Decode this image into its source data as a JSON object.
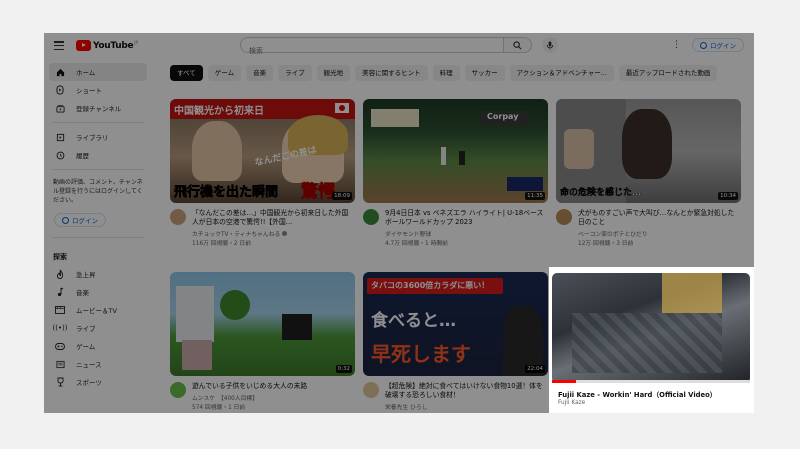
{
  "header": {
    "logo_text": "YouTube",
    "logo_region": "JP",
    "search_placeholder": "検索",
    "login_label": "ログイン"
  },
  "sidebar": {
    "primary": [
      {
        "label": "ホーム",
        "icon": "home-icon"
      },
      {
        "label": "ショート",
        "icon": "shorts-icon"
      },
      {
        "label": "登録チャンネル",
        "icon": "subscriptions-icon"
      }
    ],
    "secondary": [
      {
        "label": "ライブラリ",
        "icon": "library-icon"
      },
      {
        "label": "履歴",
        "icon": "history-icon"
      }
    ],
    "note": "動画の評価、コメント、チャンネル登録を行うにはログインしてください。",
    "login_label": "ログイン",
    "explore_heading": "探索",
    "explore": [
      {
        "label": "急上昇",
        "icon": "trending-icon"
      },
      {
        "label": "音楽",
        "icon": "music-icon"
      },
      {
        "label": "ムービー＆TV",
        "icon": "movie-icon"
      },
      {
        "label": "ライブ",
        "icon": "live-icon"
      },
      {
        "label": "ゲーム",
        "icon": "gaming-icon"
      },
      {
        "label": "ニュース",
        "icon": "news-icon"
      },
      {
        "label": "スポーツ",
        "icon": "sports-icon"
      }
    ]
  },
  "chips": [
    "すべて",
    "ゲーム",
    "音楽",
    "ライブ",
    "観光地",
    "美容に関するヒント",
    "料理",
    "サッカー",
    "アクション＆アドベンチャー...",
    "最近アップロードされた動画"
  ],
  "videos": [
    {
      "title": "「なんだこの差は…」中国観光から初来日した外国人が日本の空港で驚愕!!【外国...",
      "channel": "カチョックTV・ティナちゃんねる",
      "stats": "116万 回視聴・2 日前",
      "duration": "18:09",
      "thumb_texts": [
        "中国観光から初来日",
        "飛行機を出た瞬間",
        "驚愕",
        "なんだこの差は"
      ]
    },
    {
      "title": "9月4日日本 vs ベネズエラ ハイライト| U-18ベースボールワールドカップ 2023",
      "channel": "ダイヤモンド野球",
      "stats": "4.7万 回視聴・1 時間前",
      "duration": "11:35",
      "thumb_texts": [
        "Corpay"
      ]
    },
    {
      "title": "犬がものすごい声で大叫び…なんとか緊急対処した日のこと",
      "channel": "ベーコン家のポテとひだり",
      "stats": "12万 回視聴・3 日前",
      "duration": "10:34",
      "thumb_texts": [
        "命の危険を感じた…"
      ]
    },
    {
      "title": "遊んでいる子供をいじめる大人の末路",
      "channel": "ムンスケ　【400人目標】",
      "stats": "574 回視聴・1 日前",
      "duration": "0:32",
      "thumb_texts": []
    },
    {
      "title": "【超危険】絶対に食べてはいけない食物10選！体を破壊する恐ろしい食材！",
      "channel": "栄養先生 ひろし",
      "stats": "",
      "duration": "22:04",
      "thumb_texts": [
        "タバコの3600倍カラダに悪い！",
        "食べると…",
        "早死します"
      ]
    }
  ],
  "popup": {
    "title": "Fujii Kaze - Workin' Hard（Official Video）",
    "channel": "Fujii Kaze",
    "progress": 0.12
  }
}
